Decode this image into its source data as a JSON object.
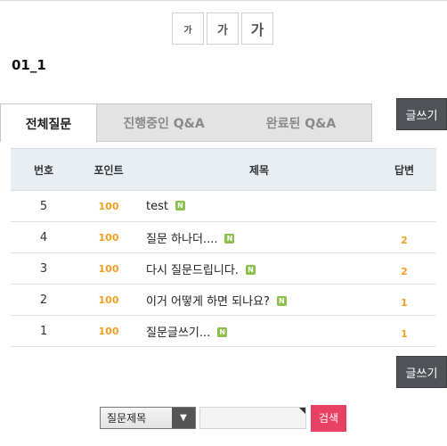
{
  "font_size_buttons": [
    {
      "label": "가"
    },
    {
      "label": "가"
    },
    {
      "label": "가"
    }
  ],
  "page_title": "01_1",
  "tabs": [
    {
      "label": "전체질문",
      "active": true
    },
    {
      "label": "진행중인 Q&A",
      "active": false
    },
    {
      "label": "완료된 Q&A",
      "active": false
    }
  ],
  "write_button_label": "글쓰기",
  "table": {
    "headers": {
      "number": "번호",
      "point": "포인트",
      "title": "제목",
      "answer": "답변"
    },
    "rows": [
      {
        "number": "5",
        "point": "100",
        "title": "test",
        "badge": "N",
        "answer": ""
      },
      {
        "number": "4",
        "point": "100",
        "title": "질문 하나더....",
        "badge": "N",
        "answer": "2"
      },
      {
        "number": "3",
        "point": "100",
        "title": "다시 질문드립니다.",
        "badge": "N",
        "answer": "2"
      },
      {
        "number": "2",
        "point": "100",
        "title": "이거 어떻게 하면 되나요?",
        "badge": "N",
        "answer": "1"
      },
      {
        "number": "1",
        "point": "100",
        "title": "질문글쓰기...",
        "badge": "N",
        "answer": "1"
      }
    ]
  },
  "search": {
    "select_value": "질문제목",
    "input_value": "",
    "button_label": "검색"
  },
  "colors": {
    "accent_orange": "#f0a020",
    "badge_green": "#8ac04b",
    "search_button": "#e94163",
    "write_button": "#4f5357"
  }
}
